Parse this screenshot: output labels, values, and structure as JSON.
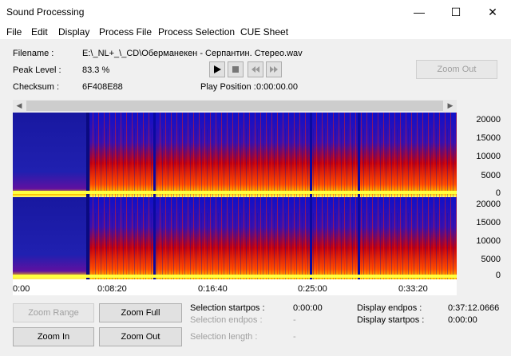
{
  "window": {
    "title": "Sound Processing",
    "minimize": "—",
    "maximize": "☐",
    "close": "✕"
  },
  "menu": {
    "file": "File",
    "edit": "Edit",
    "display": "Display",
    "process_file": "Process File",
    "process_selection": "Process Selection",
    "cue_sheet": "CUE Sheet"
  },
  "info": {
    "filename_label": "Filename :",
    "filename_value": "E:\\_NL+_\\_CD\\Оберманекен - Серпантин. Стерео.wav",
    "peak_label": "Peak Level :",
    "peak_value": "83.3 %",
    "checksum_label": "Checksum :",
    "checksum_value": "6F408E88",
    "play_position_label": "Play Position :",
    "play_position_value": "0:00:00.00",
    "zoom_out_top": "Zoom Out"
  },
  "transport": {
    "play_icon": "play-icon",
    "stop_icon": "stop-icon",
    "rewind_icon": "rewind-icon",
    "forward_icon": "fast-forward-icon"
  },
  "spectrogram": {
    "y_ticks": [
      "20000",
      "15000",
      "10000",
      "5000",
      "0"
    ],
    "x_ticks": [
      "0:00",
      "0:08:20",
      "0:16:40",
      "0:25:00",
      "0:33:20"
    ],
    "colors": {
      "low": "#0b0bd8",
      "mid": "#e00000",
      "high": "#ffcc00",
      "peak": "#ffff60"
    }
  },
  "buttons": {
    "zoom_range": "Zoom Range",
    "zoom_full": "Zoom Full",
    "zoom_in": "Zoom In",
    "zoom_out": "Zoom Out"
  },
  "selection": {
    "startpos_label": "Selection startpos :",
    "startpos_value": "0:00:00",
    "endpos_label": "Selection endpos :",
    "endpos_value": "-",
    "length_label": "Selection length :",
    "length_value": "-"
  },
  "display": {
    "endpos_label": "Display endpos :",
    "endpos_value": "0:37:12.0666",
    "startpos_label": "Display startpos :",
    "startpos_value": "0:00:00"
  }
}
